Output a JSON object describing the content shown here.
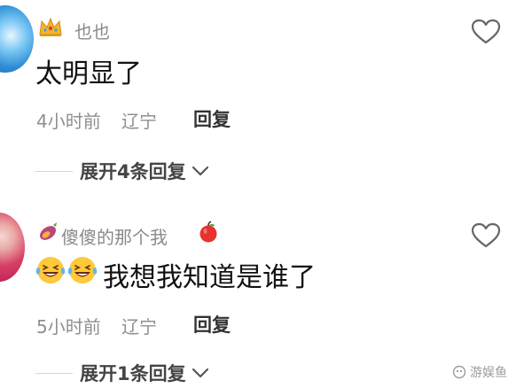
{
  "colors": {
    "background": "#ffffff",
    "name": "#8a8a8a",
    "content": "#111111",
    "meta": "#8f8f8f",
    "action": "#333333",
    "expand": "#444444",
    "icon": "#666666"
  },
  "comments": [
    {
      "name": "也也",
      "name_icon": "crown-icon",
      "content": "太明显了",
      "time": "4小时前",
      "location": "辽宁",
      "reply_label": "回复",
      "expand_label": "展开4条回复",
      "like_icon": "heart-icon"
    },
    {
      "name": "傻傻的那个我",
      "name_icon_left": "sweet-potato-icon",
      "name_icon_right": "apple-icon",
      "content_emoji": [
        "laughing-tears-icon",
        "laughing-tears-icon"
      ],
      "content": "我想我知道是谁了",
      "time": "5小时前",
      "location": "辽宁",
      "reply_label": "回复",
      "expand_label": "展开1条回复",
      "like_icon": "heart-icon"
    }
  ],
  "watermark": {
    "icon": "watermark-logo-icon",
    "text": "游娱鱼"
  }
}
